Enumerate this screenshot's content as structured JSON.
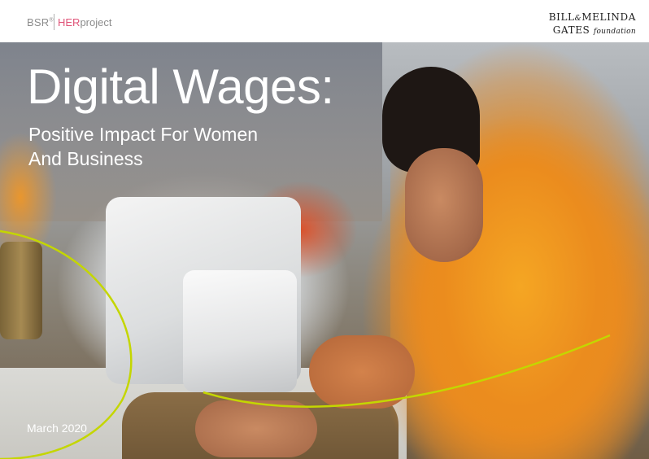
{
  "header": {
    "bsr_logo": "BSR",
    "bsr_mark": "®",
    "herproject_prefix": "HER",
    "herproject_suffix": "project",
    "foundation_line1_a": "BILL",
    "foundation_amp": "&",
    "foundation_line1_b": "MELINDA",
    "foundation_line2": "GATES",
    "foundation_word": "foundation"
  },
  "cover": {
    "title": "Digital Wages:",
    "subtitle": "Positive Impact For Women And Business",
    "date": "March 2020"
  },
  "colors": {
    "accent_line": "#c4d600",
    "her_accent": "#e0567a",
    "title_text": "#ffffff"
  }
}
